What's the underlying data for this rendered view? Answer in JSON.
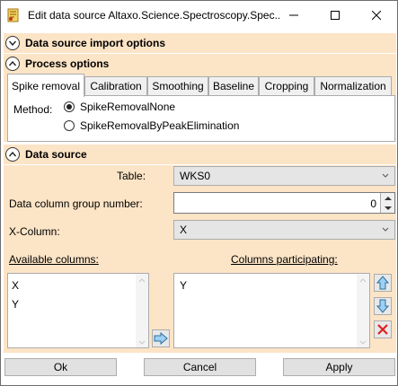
{
  "window": {
    "title": "Edit data source Altaxo.Science.Spectroscopy.Spec..."
  },
  "sections": {
    "import_options": "Data source import options",
    "process_options": "Process options",
    "data_source": "Data source"
  },
  "tabs": [
    {
      "label": "Spike removal",
      "active": true
    },
    {
      "label": "Calibration",
      "active": false
    },
    {
      "label": "Smoothing",
      "active": false
    },
    {
      "label": "Baseline",
      "active": false
    },
    {
      "label": "Cropping",
      "active": false
    },
    {
      "label": "Normalization",
      "active": false
    }
  ],
  "spike_removal": {
    "method_label": "Method:",
    "options": [
      {
        "label": "SpikeRemovalNone",
        "selected": true
      },
      {
        "label": "SpikeRemovalByPeakElimination",
        "selected": false
      }
    ]
  },
  "data_source": {
    "table_label": "Table:",
    "table_value": "WKS0",
    "group_label": "Data column group number:",
    "group_value": "0",
    "xcolumn_label": "X-Column:",
    "xcolumn_value": "X",
    "available_label": "Available columns:",
    "available_columns": [
      "X",
      "Y"
    ],
    "participating_label": "Columns participating:",
    "participating_columns": [
      "Y"
    ]
  },
  "buttons": {
    "ok": "Ok",
    "cancel": "Cancel",
    "apply": "Apply"
  },
  "colors": {
    "panel_bg": "#fce4c6",
    "arrow_blue": "#5aa9e6",
    "delete_red": "#e02020"
  }
}
